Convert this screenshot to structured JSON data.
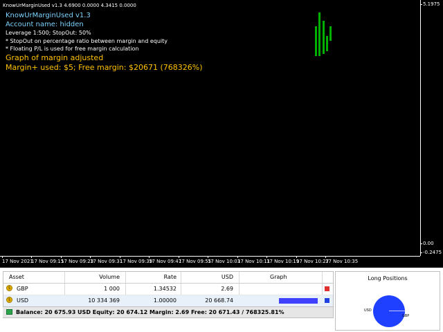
{
  "chart": {
    "title_bar": "KnowUrMarginUsed v1.3 4.6900 0.0000 4.3415 0.0000",
    "info_lines": {
      "app": "KnowUrMarginUsed v1.3",
      "account": "Account name: hidden",
      "leverage": "Leverage 1:500; StopOut: 50%",
      "note1": "* StopOut on percentage ratio between margin and equity",
      "note2": "* Floating P/L is used for free margin calculation",
      "heading": "Graph of margin adjusted",
      "margin": "Margin+ used: $5; Free margin: $20671 (768326%)"
    },
    "price_scale": {
      "top": "5.1975",
      "zero": "0.00",
      "bottom": "-0.2475"
    },
    "time_labels": [
      "17 Nov 2021",
      "17 Nov 09:15",
      "17 Nov 09:23",
      "17 Nov 09:31",
      "17 Nov 09:39",
      "17 Nov 09:47",
      "17 Nov 09:55",
      "17 Nov 10:03",
      "17 Nov 10:11",
      "17 Nov 10:19",
      "17 Nov 10:27",
      "17 Nov 10:35"
    ],
    "colors": {
      "background": "#000000",
      "bars": "#00b000",
      "info": "#7ed3ff",
      "highlight": "#ffc200"
    }
  },
  "table": {
    "headers": {
      "asset": "Asset",
      "volume": "Volume",
      "rate": "Rate",
      "usd": "USD",
      "graph": "Graph"
    },
    "rows": [
      {
        "asset": "GBP",
        "volume": "1 000",
        "rate": "1.34532",
        "usd": "2.69",
        "fill": 0.0,
        "marker_color": "#e03030"
      },
      {
        "asset": "USD",
        "volume": "10 334 369",
        "rate": "1.00000",
        "usd": "20 668.74",
        "fill": 1.0,
        "marker_color": "#2040e0"
      }
    ],
    "status": "Balance: 20 675.93 USD  Equity: 20 674.12  Margin: 2.69  Free: 20 671.43 / 768325.81%"
  },
  "long_positions": {
    "title": "Long Positions",
    "labels": {
      "usd": "USD",
      "gbp": "GBP"
    },
    "color": "#2040ff"
  }
}
